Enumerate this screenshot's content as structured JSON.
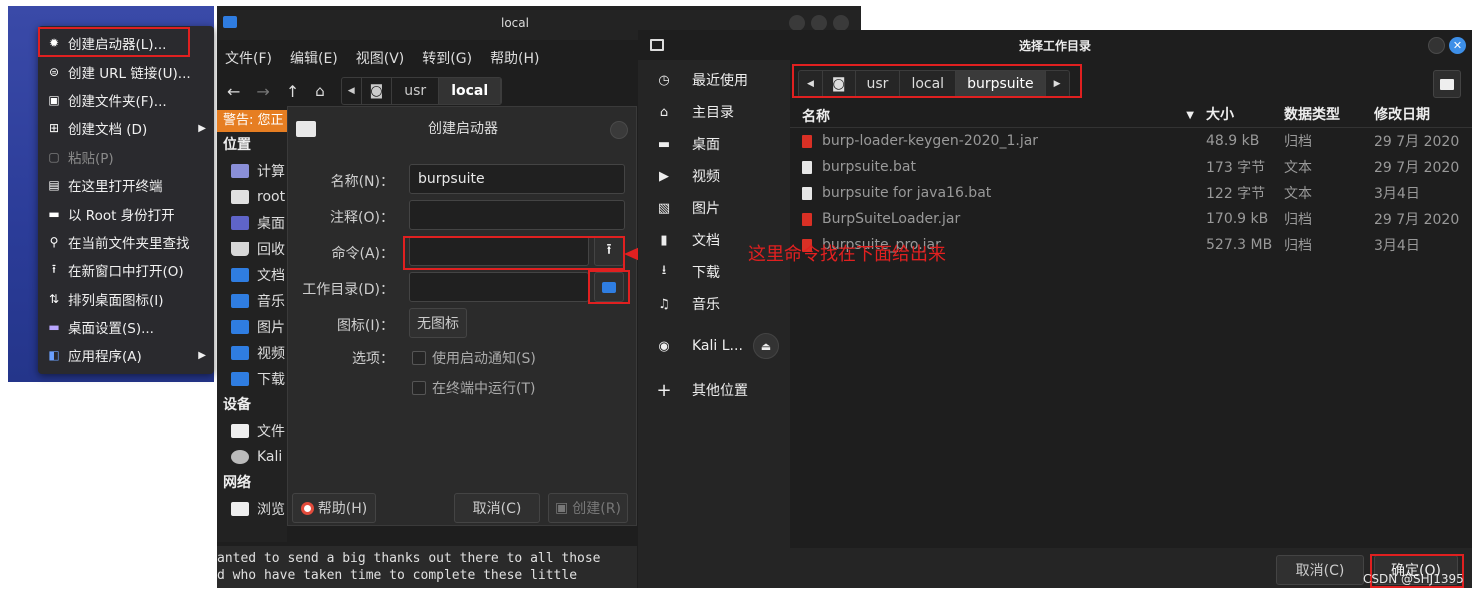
{
  "context_menu": {
    "items": [
      {
        "label": "创建启动器(L)...",
        "icon": "gear-icon"
      },
      {
        "label": "创建 URL 链接(U)...",
        "icon": "link-icon"
      },
      {
        "label": "创建文件夹(F)...",
        "icon": "new-folder-icon"
      },
      {
        "label": "创建文档 (D)",
        "icon": "new-document-icon"
      },
      {
        "label": "粘贴(P)",
        "icon": "paste-icon"
      },
      {
        "label": "在这里打开终端",
        "icon": "terminal-icon"
      },
      {
        "label": "以 Root 身份打开",
        "icon": "folder-icon"
      },
      {
        "label": "在当前文件夹里查找",
        "icon": "search-icon"
      },
      {
        "label": "在新窗口中打开(O)",
        "icon": "upload-icon"
      },
      {
        "label": "排列桌面图标(I)",
        "icon": "sort-icon"
      },
      {
        "label": "桌面设置(S)...",
        "icon": "desktop-icon"
      },
      {
        "label": "应用程序(A)",
        "icon": "apps-icon"
      }
    ]
  },
  "file_manager": {
    "title": "local",
    "menu": [
      "文件(F)",
      "编辑(E)",
      "视图(V)",
      "转到(G)",
      "帮助(H)"
    ],
    "path": [
      "usr",
      "local"
    ],
    "warning": "警告: 您正",
    "sidebar": {
      "places_header": "位置",
      "places": [
        "计算",
        "root",
        "桌面",
        "回收",
        "文档",
        "音乐",
        "图片",
        "视频",
        "下载"
      ],
      "devices_header": "设备",
      "devices": [
        "文件",
        "Kali"
      ],
      "network_header": "网络",
      "network": [
        "浏览"
      ]
    },
    "terminal_lines": [
      "anted to send a big thanks out there to all those",
      "d who have taken time to complete these little"
    ]
  },
  "launcher": {
    "title": "创建启动器",
    "name_label": "名称(N)：",
    "name_value": "burpsuite",
    "comment_label": "注释(O)：",
    "command_label": "命令(A)：",
    "workdir_label": "工作目录(D)：",
    "icon_label": "图标(I)：",
    "icon_value": "无图标",
    "options_label": "选项：",
    "opt_notify": "使用启动通知(S)",
    "opt_terminal": "在终端中运行(T)",
    "help_btn": "帮助(H)",
    "cancel_btn": "取消(C)",
    "create_btn": "创建(R)"
  },
  "annotation": {
    "text": "这里命令找在下面给出来"
  },
  "select_dir": {
    "title": "选择工作目录",
    "places": [
      {
        "label": "最近使用",
        "icon": "clock-icon"
      },
      {
        "label": "主目录",
        "icon": "home-icon"
      },
      {
        "label": "桌面",
        "icon": "desktop-icon"
      },
      {
        "label": "视频",
        "icon": "video-icon"
      },
      {
        "label": "图片",
        "icon": "image-icon"
      },
      {
        "label": "文档",
        "icon": "document-icon"
      },
      {
        "label": "下载",
        "icon": "download-icon"
      },
      {
        "label": "音乐",
        "icon": "music-icon"
      }
    ],
    "device": "Kali L...",
    "other": "其他位置",
    "path": [
      "usr",
      "local",
      "burpsuite"
    ],
    "columns": {
      "name": "名称",
      "size": "大小",
      "type": "数据类型",
      "date": "修改日期"
    },
    "files": [
      {
        "name": "burp-loader-keygen-2020_1.jar",
        "size": "48.9 kB",
        "type": "归档",
        "date": "29 7月 2020",
        "kind": "jar"
      },
      {
        "name": "burpsuite.bat",
        "size": "173 字节",
        "type": "文本",
        "date": "29 7月 2020",
        "kind": "text"
      },
      {
        "name": "burpsuite for java16.bat",
        "size": "122 字节",
        "type": "文本",
        "date": "3月4日",
        "kind": "text"
      },
      {
        "name": "BurpSuiteLoader.jar",
        "size": "170.9 kB",
        "type": "归档",
        "date": "29 7月 2020",
        "kind": "jar"
      },
      {
        "name": "burpsuite_pro.jar",
        "size": "527.3 MB",
        "type": "归档",
        "date": "3月4日",
        "kind": "jar"
      }
    ],
    "cancel_btn": "取消(C)",
    "ok_btn": "确定(O)"
  },
  "watermark": "CSDN @SHJ1395",
  "colors": {
    "accent_red": "#e02020",
    "warning": "#e67e22",
    "folder_blue": "#2f7de1",
    "jar_red": "#d93025"
  }
}
